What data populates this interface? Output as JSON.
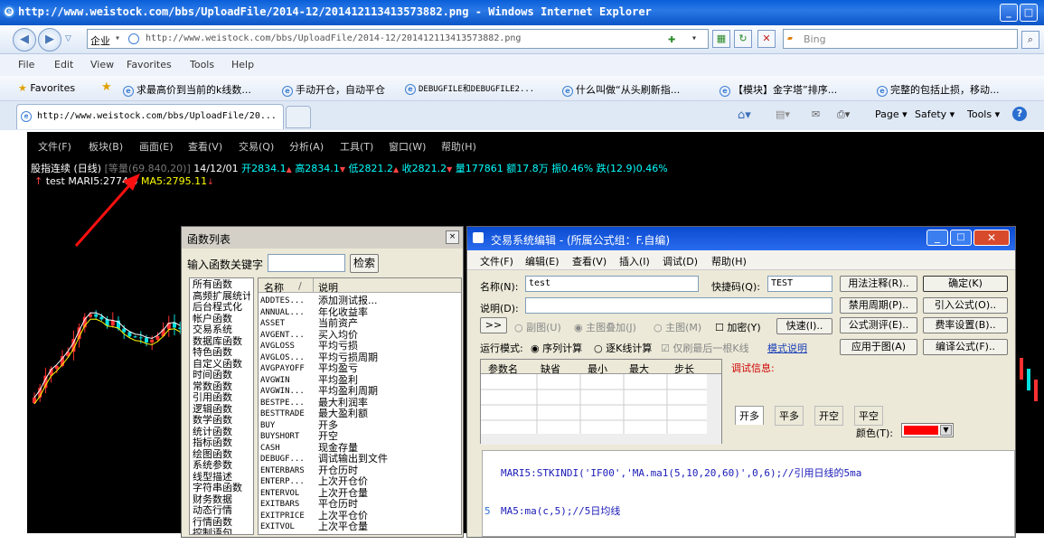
{
  "browser": {
    "title": "http://www.weistock.com/bbs/UploadFile/2014-12/201412113413573882.png - Windows Internet Explorer",
    "address": "http://www.weistock.com/bbs/UploadFile/2014-12/201412113413573882.png",
    "zone": "企业",
    "search_placeholder": "Bing",
    "menu": [
      "File",
      "Edit",
      "View",
      "Favorites",
      "Tools",
      "Help"
    ],
    "favorites_label": "Favorites",
    "favorites": [
      "求最高价到当前的k线数...",
      "手动开仓，自动平仓",
      "DEBUGFILE和DEBUGFILE2...",
      "什么叫做“从头刷新指...",
      "【模块】金字塔”排序...",
      "完整的包括止损，移动..."
    ],
    "tab_title": "http://www.weistock.com/bbs/UploadFile/20...",
    "toolbar": {
      "page": "Page",
      "safety": "Safety",
      "tools": "Tools"
    }
  },
  "app": {
    "menu": [
      "文件(F)",
      "板块(B)",
      "画面(E)",
      "查看(V)",
      "交易(Q)",
      "分析(A)",
      "工具(T)",
      "窗口(W)",
      "帮助(H)"
    ],
    "info": {
      "name": "股指连续 (日线)",
      "extra": "[等量(69.840,20)]",
      "date": "14/12/01",
      "open": "开2834.1",
      "high": "高2834.1",
      "low": "低2821.2",
      "close": "收2821.2",
      "vol": "量177861",
      "amount": "额17.8万",
      "amp": "振0.46%",
      "chg": "跌(12.9)0.46%"
    },
    "indicator": {
      "name": "test",
      "mari": "MARI5:2774.4",
      "ma": "MA5:2795.11"
    },
    "colors": {
      "bg": "#000000",
      "up": "#ff3030",
      "down": "#00e0e0",
      "ma_yellow": "#ffff00"
    }
  },
  "funclist": {
    "title": "函数列表",
    "search_label": "输入函数关键字",
    "search_button": "检索",
    "categories": [
      "所有函数",
      "高频扩展统计",
      "后台程式化",
      "帐户函数",
      "交易系统",
      "数据库函数",
      "特色函数",
      "自定义函数",
      "时间函数",
      "常数函数",
      "引用函数",
      "逻辑函数",
      "数学函数",
      "统计函数",
      "指标函数",
      "绘图函数",
      "系统参数",
      "线型描述",
      "字符串函数",
      "财务数据",
      "动态行情",
      "行情函数",
      "控制语句"
    ],
    "col_name": "名称",
    "col_desc": "说明",
    "functions": [
      [
        "ADDTES...",
        "添加测试报..."
      ],
      [
        "ANNUAL...",
        "年化收益率"
      ],
      [
        "ASSET",
        "当前资产"
      ],
      [
        "AVGENT...",
        "买入均价"
      ],
      [
        "AVGLOSS",
        "平均亏损"
      ],
      [
        "AVGLOS...",
        "平均亏损周期"
      ],
      [
        "AVGPAYOFF",
        "平均盈亏"
      ],
      [
        "AVGWIN",
        "平均盈利"
      ],
      [
        "AVGWIN...",
        "平均盈利周期"
      ],
      [
        "BESTPE...",
        "最大利润率"
      ],
      [
        "BESTTRADE",
        "最大盈利额"
      ],
      [
        "BUY",
        "开多"
      ],
      [
        "BUYSHORT",
        "开空"
      ],
      [
        "CASH",
        "现金存量"
      ],
      [
        "DEBUGF...",
        "调试输出到文件"
      ],
      [
        "ENTERBARS",
        "开仓历时"
      ],
      [
        "ENTERP...",
        "上次开仓价"
      ],
      [
        "ENTERVOL",
        "上次开仓量"
      ],
      [
        "EXITBARS",
        "平仓历时"
      ],
      [
        "EXITPRICE",
        "上次平仓价"
      ],
      [
        "EXITVOL",
        "上次平仓量"
      ]
    ]
  },
  "editor": {
    "title": "交易系统编辑 - (所属公式组：F.自编)",
    "menu": [
      "文件(F)",
      "编辑(E)",
      "查看(V)",
      "插入(I)",
      "调试(D)",
      "帮助(H)"
    ],
    "name_label": "名称(N):",
    "name_value": "test",
    "shortcut_label": "快捷码(Q):",
    "shortcut_value": "TEST",
    "desc_label": "说明(D):",
    "buttons": [
      "用法注释(R)..",
      "确定(K)",
      "禁用周期(P)..",
      "引入公式(O)..",
      "公式测评(E)..",
      "费率设置(B)..",
      "应用于图(A)",
      "编译公式(F).."
    ],
    "expand": ">>",
    "radio_sub": "副图(U)",
    "radio_main": "主图叠加(J)",
    "radio_mainchart": "主图(M)",
    "encrypt": "加密(Y)",
    "quick": "快速(I)..",
    "mode_label": "运行模式:",
    "mode_seq": "序列计算",
    "mode_tick": "逐K线计算",
    "mode_last": "仅刷最后一根K线",
    "mode_link": "模式说明",
    "param_headers": [
      "参数名",
      "缺省",
      "最小",
      "最大",
      "步长"
    ],
    "debug_label": "调试信息:",
    "tabs": [
      "开多",
      "平多",
      "开空",
      "平空"
    ],
    "color_label": "颜色(T):",
    "color_value": "#ff0000",
    "code_lines": [
      {
        "num": "",
        "text": "MARI5:STKINDI('IF00','MA.ma1(5,10,20,60)',0,6);//引用日线的5ma"
      },
      {
        "num": "5",
        "text": "MA5:ma(c,5);//5日均线"
      }
    ]
  }
}
